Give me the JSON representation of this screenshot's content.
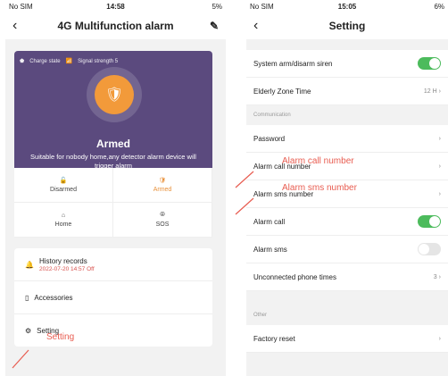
{
  "phone1": {
    "status": {
      "carrier": "No SIM",
      "time": "14:58",
      "battery": "5%"
    },
    "nav": {
      "title": "4G Multifunction alarm"
    },
    "hero": {
      "charge_label": "Charge state",
      "signal_label": "Signal strength 5",
      "title": "Armed",
      "desc": "Suitable for nobody home,any detector alarm device will trigger alarm"
    },
    "modes": [
      {
        "label": "Disarmed"
      },
      {
        "label": "Armed"
      },
      {
        "label": "Home"
      },
      {
        "label": "SOS"
      }
    ],
    "menu": {
      "history_label": "History records",
      "history_time": "2022-07-20 14:57 Off",
      "accessories_label": "Accessories",
      "setting_label": "Setting"
    },
    "annotation": "Setting"
  },
  "phone2": {
    "status": {
      "carrier": "No SIM",
      "time": "15:05",
      "battery": "6%"
    },
    "nav": {
      "title": "Setting"
    },
    "rows": {
      "system_siren": "System arm/disarm siren",
      "elderly": "Elderly Zone Time",
      "elderly_val": "12 H",
      "section_comm": "Communication",
      "password": "Password",
      "call_number": "Alarm call number",
      "sms_number": "Alarm sms number",
      "alarm_call": "Alarm call",
      "alarm_sms": "Alarm sms",
      "unconnected": "Unconnected phone times",
      "unconnected_val": "3",
      "section_other": "Other",
      "factory_reset": "Factory reset"
    },
    "annotations": {
      "call": "Alarm call number",
      "sms": "Alarm sms number"
    }
  },
  "colors": {
    "accent": "#f29a3a",
    "hero_bg": "#5b4a7e",
    "toggle_on": "#4cbb5c",
    "annotation": "#e85c50"
  }
}
